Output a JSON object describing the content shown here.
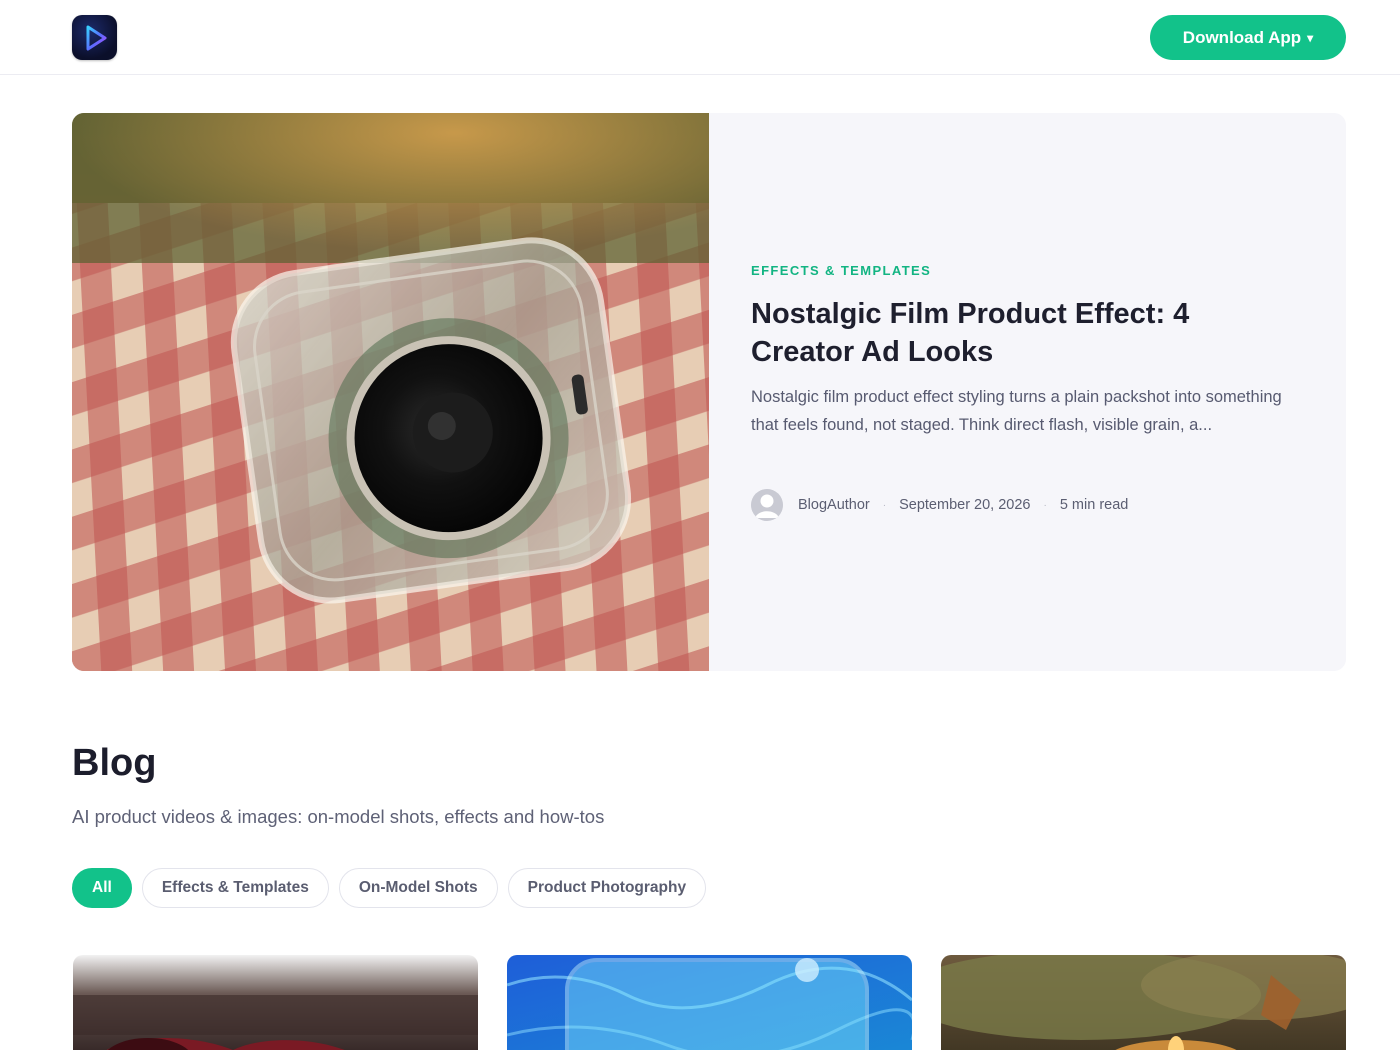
{
  "header": {
    "logo_icon": "play-logo-icon",
    "download_label": "Download App",
    "download_caret": "▾",
    "accent": "#12c28a"
  },
  "featured": {
    "category": "EFFECTS & TEMPLATES",
    "title": "Nostalgic Film Product Effect: 4 Creator Ad Looks",
    "excerpt": "Nostalgic film product effect styling turns a plain packshot into something that feels found, not staged. Think direct flash, visible grain, a...",
    "author": "BlogAuthor",
    "date": "September 20, 2026",
    "read_time": "5 min read",
    "separator": "·"
  },
  "blog": {
    "title": "Blog",
    "subtitle": "AI product videos & images: on-model shots, effects and how-tos",
    "filters": [
      "All",
      "Effects & Templates",
      "On-Model Shots",
      "Product Photography"
    ],
    "active_filter": "All"
  }
}
